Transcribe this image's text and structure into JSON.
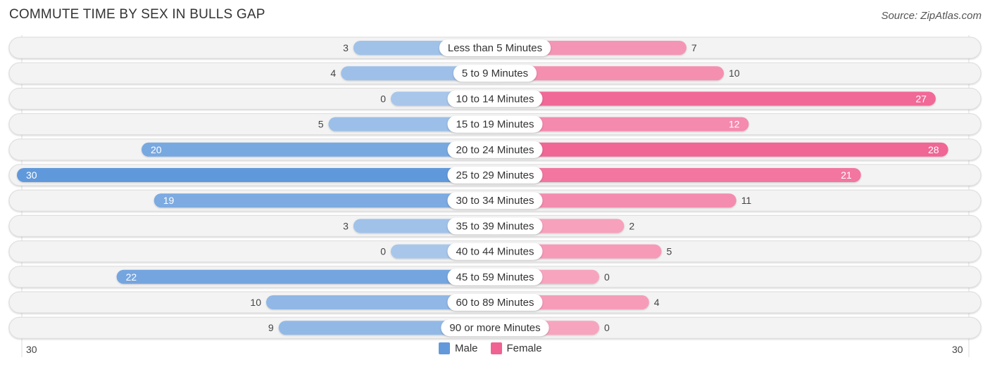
{
  "header": {
    "title": "COMMUTE TIME BY SEX IN BULLS GAP",
    "source": "Source: ZipAtlas.com"
  },
  "colors": {
    "male_strong": "#6199db",
    "male_light": "#a7c6ea",
    "female_strong": "#f06292",
    "female_light": "#f7a5bf",
    "track": "#f3f3f3",
    "legend_male": "#6199db",
    "legend_female": "#f06292"
  },
  "legend": {
    "male": "Male",
    "female": "Female"
  },
  "axis": {
    "left_label": "30",
    "right_label": "30"
  },
  "chart_data": {
    "type": "bar",
    "orientation": "horizontal-diverging",
    "title": "COMMUTE TIME BY SEX IN BULLS GAP",
    "categories": [
      "Less than 5 Minutes",
      "5 to 9 Minutes",
      "10 to 14 Minutes",
      "15 to 19 Minutes",
      "20 to 24 Minutes",
      "25 to 29 Minutes",
      "30 to 34 Minutes",
      "35 to 39 Minutes",
      "40 to 44 Minutes",
      "45 to 59 Minutes",
      "60 to 89 Minutes",
      "90 or more Minutes"
    ],
    "series": [
      {
        "name": "Male",
        "side": "left",
        "values": [
          3,
          4,
          0,
          5,
          20,
          30,
          19,
          3,
          0,
          22,
          10,
          9
        ]
      },
      {
        "name": "Female",
        "side": "right",
        "values": [
          7,
          10,
          27,
          12,
          28,
          21,
          11,
          2,
          5,
          0,
          4,
          0
        ]
      }
    ],
    "xlim": [
      -30,
      30
    ],
    "xtick_labels": [
      "30",
      "30"
    ],
    "legend_position": "bottom-center",
    "grid": false
  }
}
